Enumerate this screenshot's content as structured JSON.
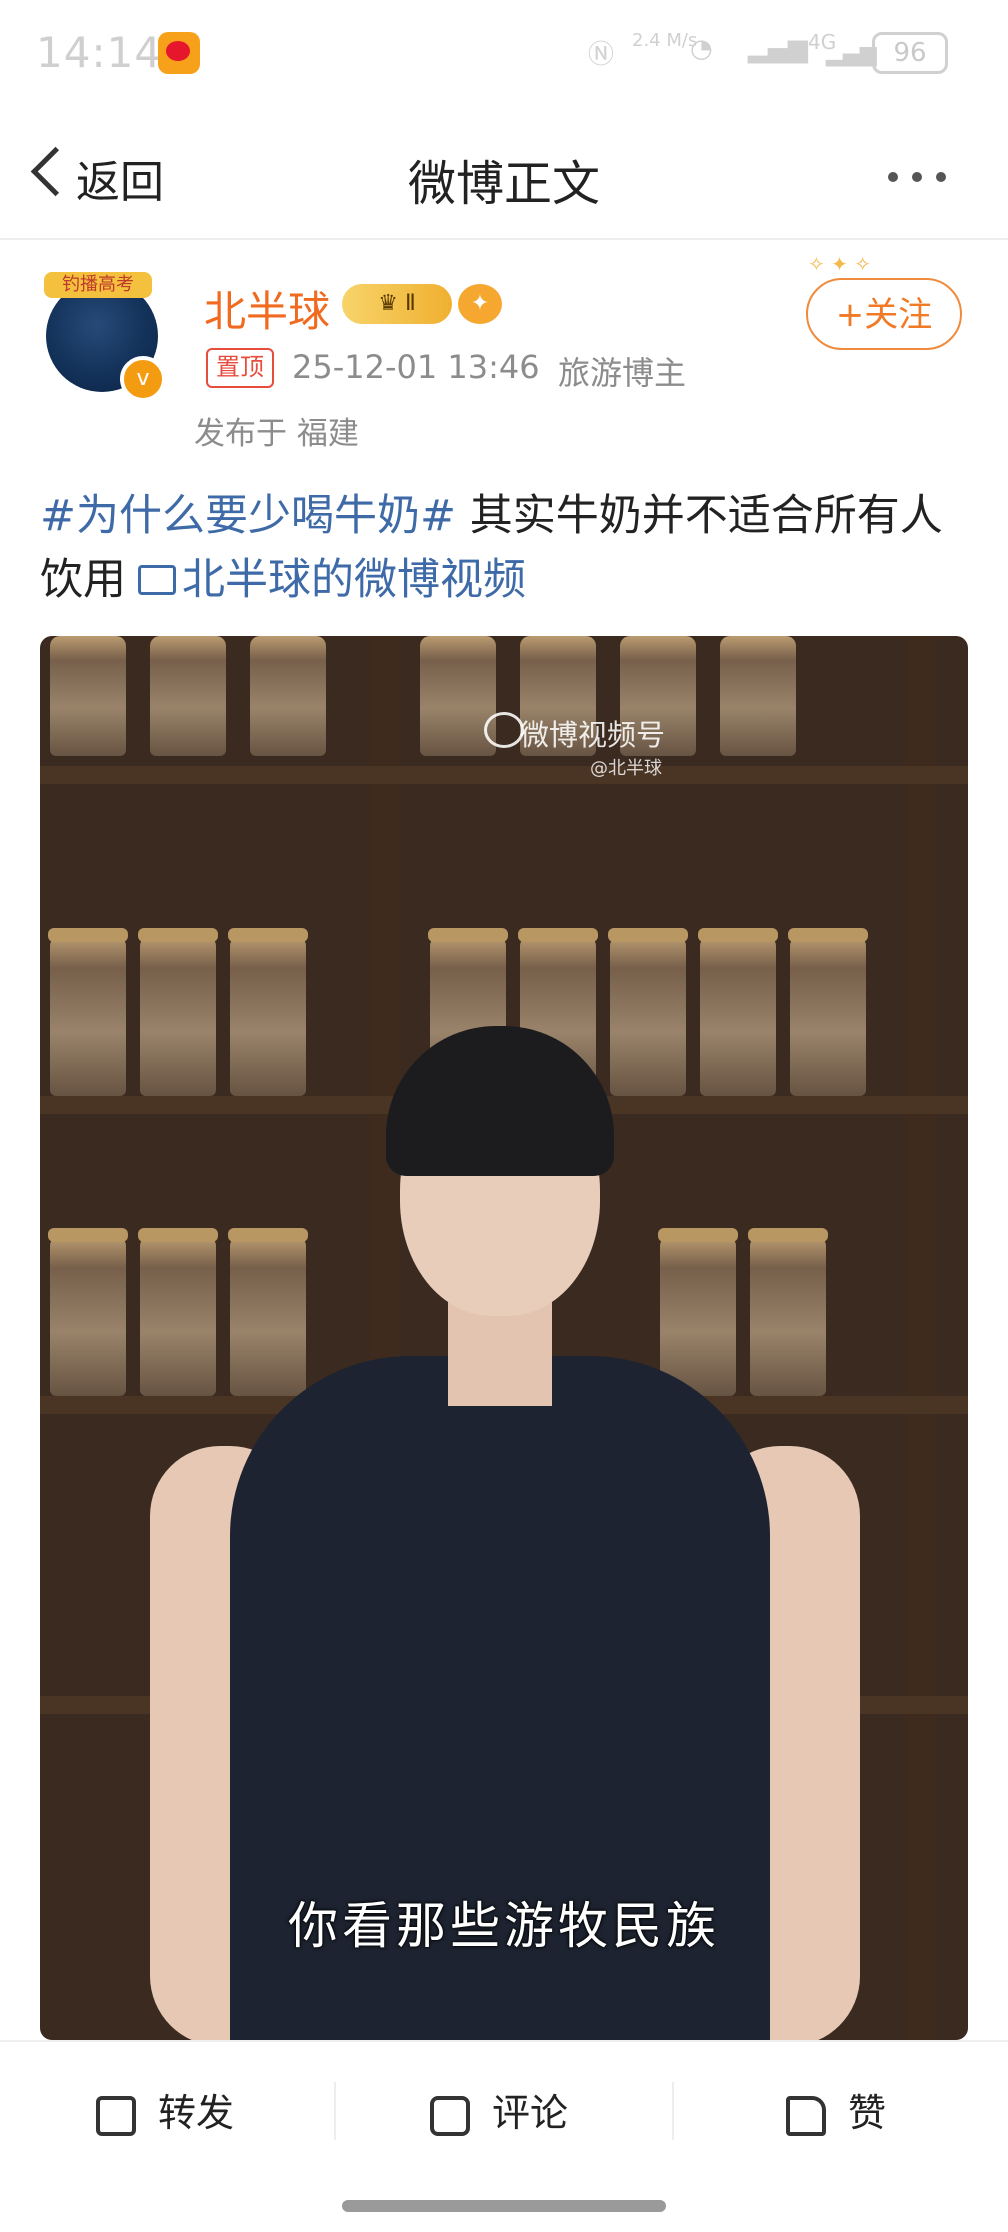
{
  "status_bar": {
    "time": "14:14",
    "network_speed": "2.4 M/s",
    "network_type": "4G",
    "battery": "96"
  },
  "nav": {
    "back_label": "返回",
    "title": "微博正文"
  },
  "author": {
    "name": "北半球",
    "vip_level": "Ⅱ",
    "avatar_banner": "钓播高考",
    "pinned_label": "置顶",
    "timestamp": "25-12-01 13:46",
    "role": "旅游博主",
    "location": "发布于 福建",
    "follow_label": "+关注"
  },
  "post": {
    "hashtag": "#为什么要少喝牛奶#",
    "text": " 其实牛奶并不适合所有人饮用",
    "video_link": "北半球的微博视频"
  },
  "video": {
    "watermark": "微博视频号",
    "watermark_handle": "@北半球",
    "subtitle": "你看那些游牧民族"
  },
  "actions": {
    "repost_label": "转发",
    "comment_label": "评论",
    "like_label": "赞"
  },
  "colors": {
    "accent": "#f07a26",
    "link": "#3f6aa8"
  }
}
